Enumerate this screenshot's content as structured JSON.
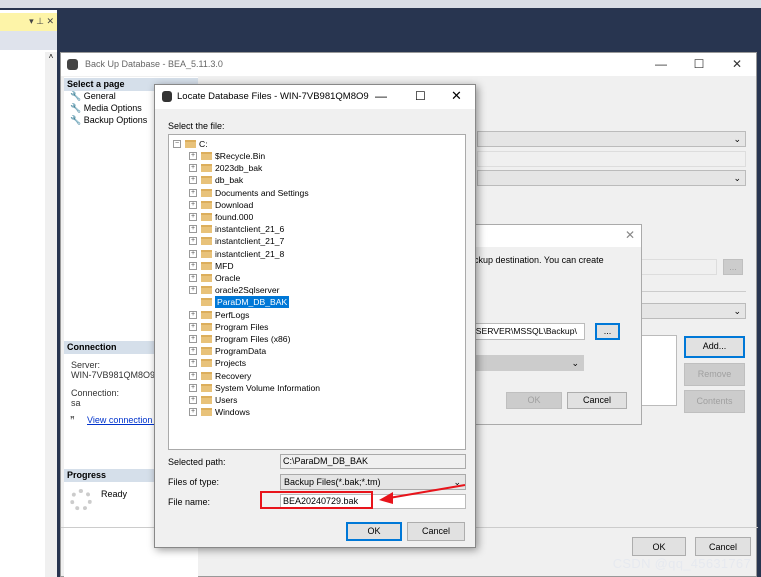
{
  "left_panel": {
    "title_icons": "▾ ⊥ ✕",
    "scroll_up": "˄"
  },
  "main_window": {
    "title": "Back Up Database - BEA_5.11.3.0",
    "controls": {
      "minimize": "—",
      "maximize": "☐",
      "close": "✕"
    },
    "sidebar": {
      "select_page_header": "Select a page",
      "pages": [
        {
          "label": "General"
        },
        {
          "label": "Media Options"
        },
        {
          "label": "Backup Options"
        }
      ],
      "connection_header": "Connection",
      "server_label": "Server:",
      "server_value": "WIN-7VB981QM8O9",
      "connection_label": "Connection:",
      "connection_value": "sa",
      "view_connection_link": "View connection p",
      "progress_header": "Progress",
      "progress_status": "Ready"
    },
    "buttons": {
      "add": "Add...",
      "remove": "Remove",
      "contents": "Contents",
      "ok": "OK",
      "cancel": "Cancel",
      "browse": "..."
    }
  },
  "backup_destination_dialog": {
    "description": "ackup destination. You can create",
    "path_value": "LSERVER\\MSSQL\\Backup\\",
    "browse": "...",
    "ok": "OK",
    "cancel": "Cancel",
    "close": "✕"
  },
  "locate_dialog": {
    "title": "Locate Database Files - WIN-7VB981QM8O9",
    "controls": {
      "minimize": "—",
      "maximize": "☐",
      "close": "✕"
    },
    "select_label": "Select the file:",
    "root": "C:",
    "folders": [
      "$Recycle.Bin",
      "2023db_bak",
      "db_bak",
      "Documents and Settings",
      "Download",
      "found.000",
      "instantclient_21_6",
      "instantclient_21_7",
      "instantclient_21_8",
      "MFD",
      "Oracle",
      "oracle2Sqlserver",
      "ParaDM_DB_BAK",
      "PerfLogs",
      "Program Files",
      "Program Files (x86)",
      "ProgramData",
      "Projects",
      "Recovery",
      "System Volume Information",
      "Users",
      "Windows"
    ],
    "selected_folder": "ParaDM_DB_BAK",
    "selected_path_label": "Selected path:",
    "selected_path_value": "C:\\ParaDM_DB_BAK",
    "files_of_type_label": "Files of type:",
    "files_of_type_value": "Backup Files(*.bak;*.tm)",
    "file_name_label": "File name:",
    "file_name_value": "BEA20240729.bak",
    "ok": "OK",
    "cancel": "Cancel"
  },
  "annotation": {
    "color": "#e8141b"
  },
  "watermark": "CSDN @qq_45631767"
}
